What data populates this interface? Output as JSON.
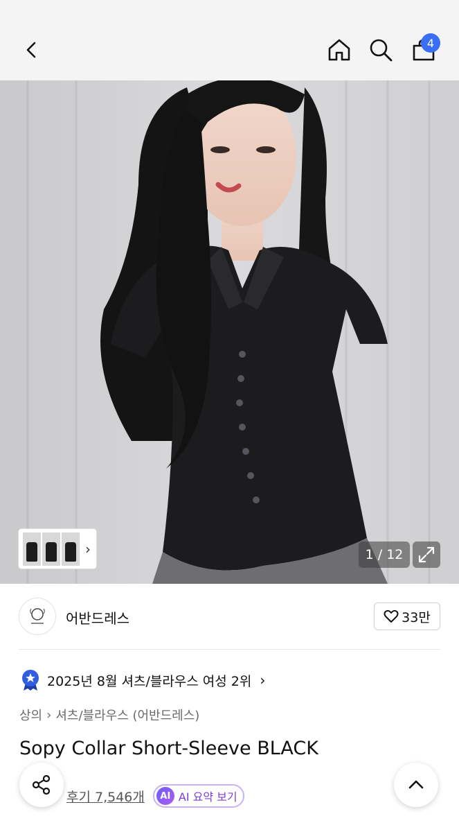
{
  "header": {
    "back_icon": "chevron-left-icon",
    "home_icon": "home-icon",
    "search_icon": "search-icon",
    "cart_icon": "shopping-bag-icon",
    "cart_count": "4",
    "badge_color": "#3b6ef5"
  },
  "gallery": {
    "counter": "1 / 12",
    "expand_icon": "expand-icon",
    "thumb_chevron": "›"
  },
  "brand": {
    "name": "어반드레스",
    "like_count": "33만",
    "like_icon": "heart-icon"
  },
  "ranking": {
    "icon": "ranking-medal-icon",
    "text": "2025년 8월 셔츠/블라우스 여성 2위",
    "chevron": "›"
  },
  "breadcrumb": {
    "items": [
      "상의",
      "셔츠/블라우스 (어반드레스)"
    ],
    "separator": "›"
  },
  "product": {
    "title": "Sopy Collar Short-Sleeve BLACK"
  },
  "reviews": {
    "link_text": "후기 7,546개",
    "ai_badge": "AI",
    "ai_label": "AI 요약 보기",
    "ai_accent": "#7a3fd6"
  },
  "fabs": {
    "share_icon": "share-icon",
    "scroll_top_icon": "chevron-up-icon"
  }
}
